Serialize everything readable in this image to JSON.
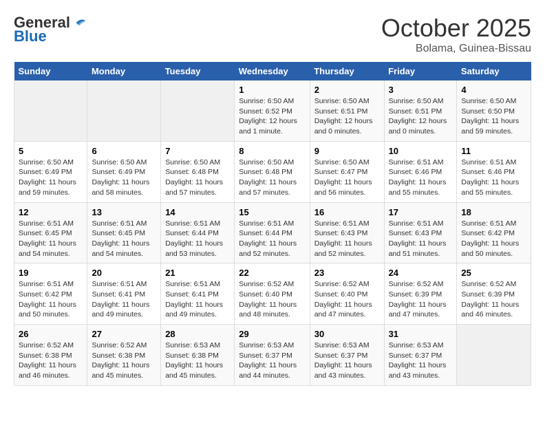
{
  "header": {
    "logo_general": "General",
    "logo_blue": "Blue",
    "month_title": "October 2025",
    "location": "Bolama, Guinea-Bissau"
  },
  "days_of_week": [
    "Sunday",
    "Monday",
    "Tuesday",
    "Wednesday",
    "Thursday",
    "Friday",
    "Saturday"
  ],
  "weeks": [
    [
      {
        "day": "",
        "info": ""
      },
      {
        "day": "",
        "info": ""
      },
      {
        "day": "",
        "info": ""
      },
      {
        "day": "1",
        "info": "Sunrise: 6:50 AM\nSunset: 6:52 PM\nDaylight: 12 hours\nand 1 minute."
      },
      {
        "day": "2",
        "info": "Sunrise: 6:50 AM\nSunset: 6:51 PM\nDaylight: 12 hours\nand 0 minutes."
      },
      {
        "day": "3",
        "info": "Sunrise: 6:50 AM\nSunset: 6:51 PM\nDaylight: 12 hours\nand 0 minutes."
      },
      {
        "day": "4",
        "info": "Sunrise: 6:50 AM\nSunset: 6:50 PM\nDaylight: 11 hours\nand 59 minutes."
      }
    ],
    [
      {
        "day": "5",
        "info": "Sunrise: 6:50 AM\nSunset: 6:49 PM\nDaylight: 11 hours\nand 59 minutes."
      },
      {
        "day": "6",
        "info": "Sunrise: 6:50 AM\nSunset: 6:49 PM\nDaylight: 11 hours\nand 58 minutes."
      },
      {
        "day": "7",
        "info": "Sunrise: 6:50 AM\nSunset: 6:48 PM\nDaylight: 11 hours\nand 57 minutes."
      },
      {
        "day": "8",
        "info": "Sunrise: 6:50 AM\nSunset: 6:48 PM\nDaylight: 11 hours\nand 57 minutes."
      },
      {
        "day": "9",
        "info": "Sunrise: 6:50 AM\nSunset: 6:47 PM\nDaylight: 11 hours\nand 56 minutes."
      },
      {
        "day": "10",
        "info": "Sunrise: 6:51 AM\nSunset: 6:46 PM\nDaylight: 11 hours\nand 55 minutes."
      },
      {
        "day": "11",
        "info": "Sunrise: 6:51 AM\nSunset: 6:46 PM\nDaylight: 11 hours\nand 55 minutes."
      }
    ],
    [
      {
        "day": "12",
        "info": "Sunrise: 6:51 AM\nSunset: 6:45 PM\nDaylight: 11 hours\nand 54 minutes."
      },
      {
        "day": "13",
        "info": "Sunrise: 6:51 AM\nSunset: 6:45 PM\nDaylight: 11 hours\nand 54 minutes."
      },
      {
        "day": "14",
        "info": "Sunrise: 6:51 AM\nSunset: 6:44 PM\nDaylight: 11 hours\nand 53 minutes."
      },
      {
        "day": "15",
        "info": "Sunrise: 6:51 AM\nSunset: 6:44 PM\nDaylight: 11 hours\nand 52 minutes."
      },
      {
        "day": "16",
        "info": "Sunrise: 6:51 AM\nSunset: 6:43 PM\nDaylight: 11 hours\nand 52 minutes."
      },
      {
        "day": "17",
        "info": "Sunrise: 6:51 AM\nSunset: 6:43 PM\nDaylight: 11 hours\nand 51 minutes."
      },
      {
        "day": "18",
        "info": "Sunrise: 6:51 AM\nSunset: 6:42 PM\nDaylight: 11 hours\nand 50 minutes."
      }
    ],
    [
      {
        "day": "19",
        "info": "Sunrise: 6:51 AM\nSunset: 6:42 PM\nDaylight: 11 hours\nand 50 minutes."
      },
      {
        "day": "20",
        "info": "Sunrise: 6:51 AM\nSunset: 6:41 PM\nDaylight: 11 hours\nand 49 minutes."
      },
      {
        "day": "21",
        "info": "Sunrise: 6:51 AM\nSunset: 6:41 PM\nDaylight: 11 hours\nand 49 minutes."
      },
      {
        "day": "22",
        "info": "Sunrise: 6:52 AM\nSunset: 6:40 PM\nDaylight: 11 hours\nand 48 minutes."
      },
      {
        "day": "23",
        "info": "Sunrise: 6:52 AM\nSunset: 6:40 PM\nDaylight: 11 hours\nand 47 minutes."
      },
      {
        "day": "24",
        "info": "Sunrise: 6:52 AM\nSunset: 6:39 PM\nDaylight: 11 hours\nand 47 minutes."
      },
      {
        "day": "25",
        "info": "Sunrise: 6:52 AM\nSunset: 6:39 PM\nDaylight: 11 hours\nand 46 minutes."
      }
    ],
    [
      {
        "day": "26",
        "info": "Sunrise: 6:52 AM\nSunset: 6:38 PM\nDaylight: 11 hours\nand 46 minutes."
      },
      {
        "day": "27",
        "info": "Sunrise: 6:52 AM\nSunset: 6:38 PM\nDaylight: 11 hours\nand 45 minutes."
      },
      {
        "day": "28",
        "info": "Sunrise: 6:53 AM\nSunset: 6:38 PM\nDaylight: 11 hours\nand 45 minutes."
      },
      {
        "day": "29",
        "info": "Sunrise: 6:53 AM\nSunset: 6:37 PM\nDaylight: 11 hours\nand 44 minutes."
      },
      {
        "day": "30",
        "info": "Sunrise: 6:53 AM\nSunset: 6:37 PM\nDaylight: 11 hours\nand 43 minutes."
      },
      {
        "day": "31",
        "info": "Sunrise: 6:53 AM\nSunset: 6:37 PM\nDaylight: 11 hours\nand 43 minutes."
      },
      {
        "day": "",
        "info": ""
      }
    ]
  ]
}
